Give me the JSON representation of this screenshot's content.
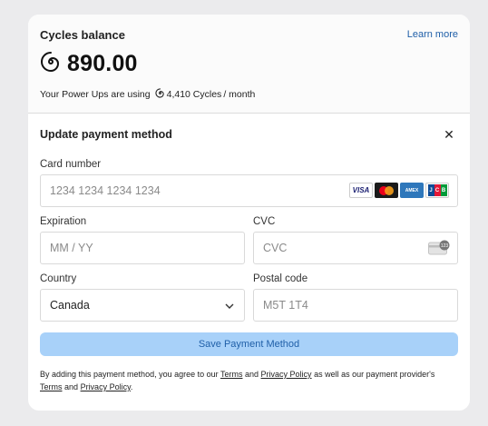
{
  "balance": {
    "title": "Cycles balance",
    "learn_more": "Learn more",
    "amount": "890.00",
    "usage_prefix": "Your Power Ups are using",
    "usage_amount": "4,410 Cycles",
    "usage_suffix": "/ month"
  },
  "payment": {
    "title": "Update payment method",
    "card_number_label": "Card number",
    "card_number_placeholder": "1234 1234 1234 1234",
    "expiration_label": "Expiration",
    "expiration_placeholder": "MM / YY",
    "cvc_label": "CVC",
    "cvc_placeholder": "CVC",
    "country_label": "Country",
    "country_value": "Canada",
    "postal_label": "Postal code",
    "postal_placeholder": "M5T 1T4",
    "save_label": "Save Payment Method",
    "card_brands": [
      "VISA",
      "mastercard",
      "AMEX",
      "JCB"
    ]
  },
  "terms": {
    "text1": "By adding this payment method, you agree to our",
    "terms_link": "Terms",
    "and": "and",
    "privacy_link": "Privacy Policy",
    "text2": "as well as our payment provider's",
    "terms_link2": "Terms",
    "and2": "and",
    "privacy_link2": "Privacy Policy",
    "period": "."
  },
  "colors": {
    "accent": "#1f5fa8",
    "save_button_bg": "#a8d1f9",
    "page_bg": "#ebebed"
  }
}
